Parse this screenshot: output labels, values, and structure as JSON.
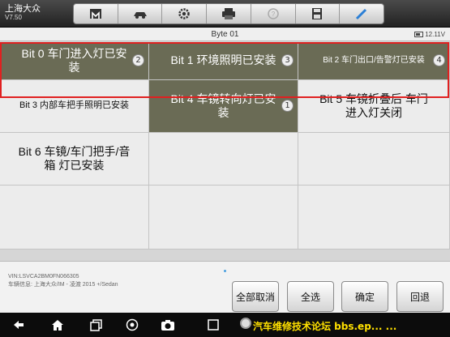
{
  "app": {
    "title": "上海大众",
    "version": "V7.50"
  },
  "toolbar": {
    "icons": [
      "home-icon",
      "car-icon",
      "settings-icon",
      "printer-icon",
      "help-icon",
      "save-icon",
      "edit-icon"
    ]
  },
  "header": {
    "title": "Byte 01",
    "battery": "12.11V"
  },
  "grid": {
    "cells": [
      {
        "label": "Bit 0 车门进入灯已安装",
        "badge": "2",
        "selected": true
      },
      {
        "label": "Bit 1 环境照明已安装",
        "badge": "3",
        "selected": true
      },
      {
        "label": "Bit 2 车门出口/告警灯已安装",
        "badge": "4",
        "selected": true
      },
      {
        "label": "Bit 3 内部车把手照明已安装",
        "badge": "",
        "selected": false
      },
      {
        "label": "Bit 4 车镜转向灯已安装",
        "badge": "1",
        "selected": true
      },
      {
        "label": "Bit 5 车镜折叠后 车门进入灯关闭",
        "badge": "",
        "selected": false
      },
      {
        "label": "Bit 6 车镜/车门把手/音箱 灯已安装",
        "badge": "",
        "selected": false
      }
    ]
  },
  "footer": {
    "vin": "VIN:LSVCA2BM0FN066305",
    "vehicle": "车辆信息: 上海大众/IM - 凌渡 2015 +/Sedan",
    "buttons": {
      "deselect_all": "全部取消",
      "select_all": "全选",
      "confirm": "确定",
      "back": "回退"
    }
  },
  "navbar": {
    "icons": [
      "back-icon",
      "home-icon",
      "recent-apps-icon",
      "browser-icon",
      "camera-icon",
      "screenshot-icon"
    ],
    "watermark": "汽车维修技术论坛 bbs.ep... ..."
  },
  "colors": {
    "selected_cell": "#6a6b55",
    "highlight_frame": "#e02020"
  }
}
